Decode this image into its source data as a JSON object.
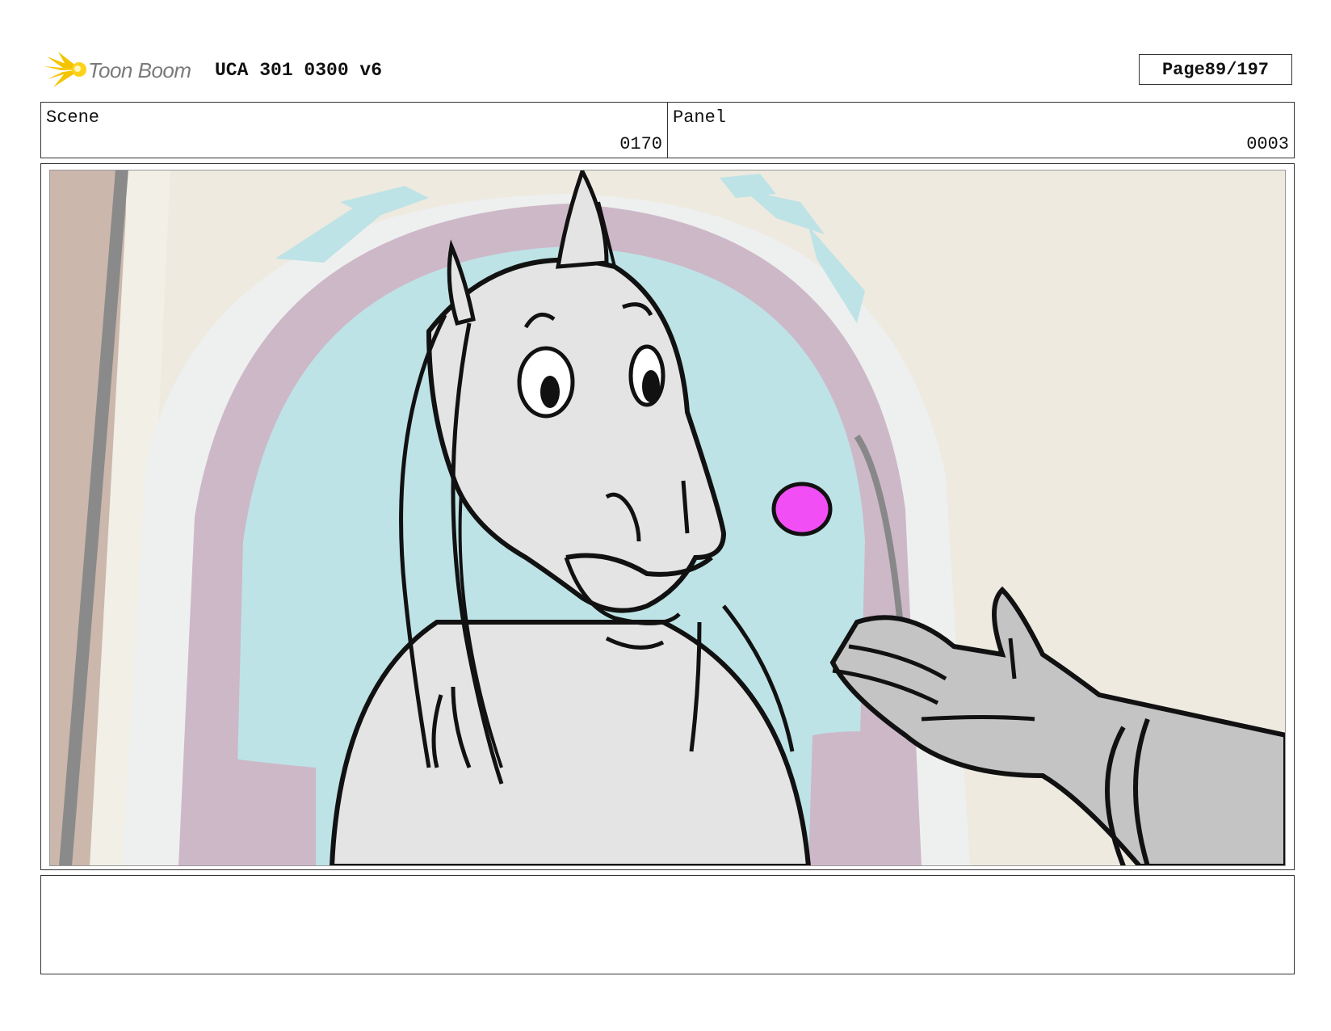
{
  "header": {
    "logo_text": "Toon Boom",
    "title": "UCA 301 0300 v6",
    "page_label": "Page",
    "page_value": "89/197"
  },
  "scene": {
    "label": "Scene",
    "value": "0170"
  },
  "panel": {
    "label": "Panel",
    "value": "0003"
  },
  "image": {
    "description_icon": "storyboard-drawing"
  },
  "colors": {
    "wall": "#eeeae0",
    "arch_purple": "#cdb8c8",
    "window_blue": "#bde3e6",
    "horse_grey": "#e4e4e4",
    "hand_grey": "#c4c4c4",
    "magenta": "#f24ef5"
  }
}
